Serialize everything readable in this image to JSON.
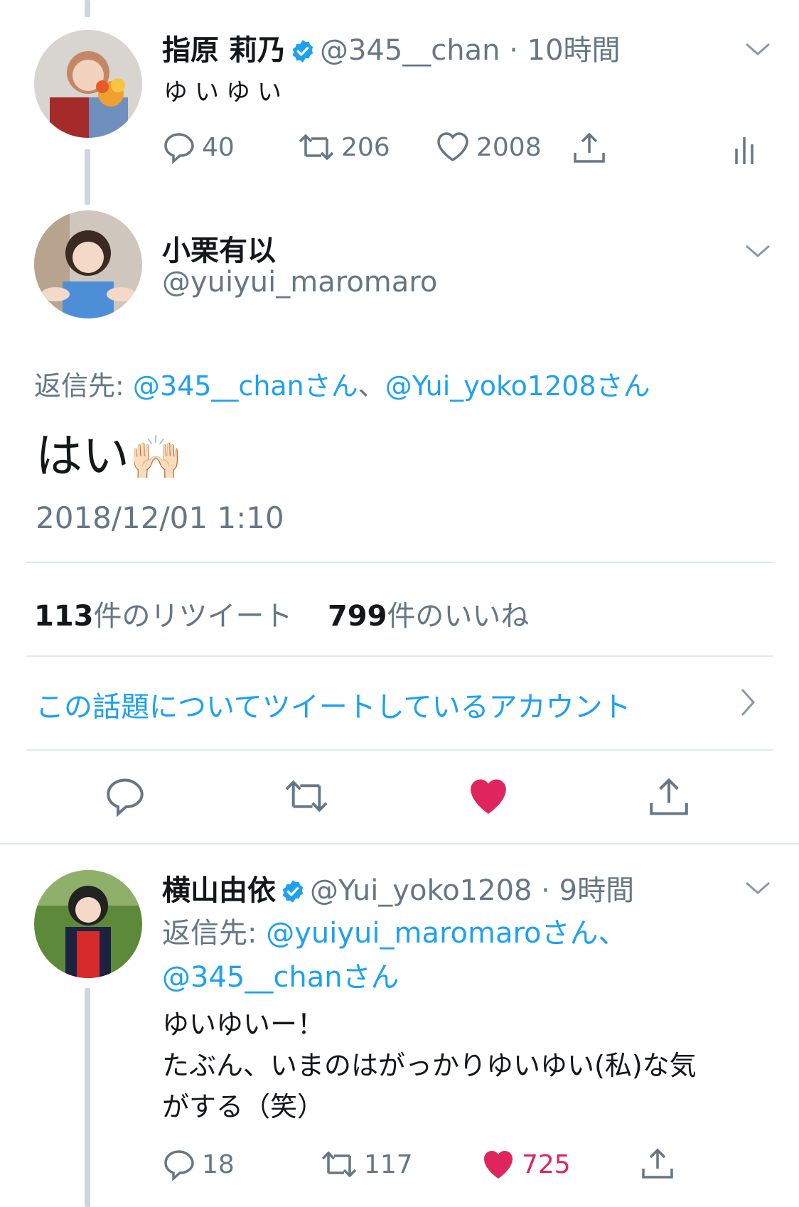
{
  "tweet1": {
    "name": "指原 莉乃",
    "handle": "@345__chan",
    "time": "10時間",
    "text": "ゆいゆい",
    "replies": "40",
    "retweets": "206",
    "likes": "2008"
  },
  "main": {
    "name": "小栗有以",
    "handle": "@yuiyui_maromaro",
    "reply_prefix": "返信先: ",
    "reply_to_1": "@345__chanさん",
    "reply_sep": "、",
    "reply_to_2": "@Yui_yoko1208さん",
    "text": "はい",
    "emoji": "🙌🏻",
    "timestamp": "2018/12/01 1:10",
    "retweet_count": "113",
    "retweet_label": "件のリツイート",
    "like_count": "799",
    "like_label": "件のいいね",
    "topic_link": "この話題についてツイートしているアカウント"
  },
  "tweet3": {
    "name": "横山由依",
    "handle": "@Yui_yoko1208",
    "time": "9時間",
    "reply_prefix": "返信先: ",
    "reply_to_1": "@yuiyui_maromaroさん、",
    "reply_to_2": "@345__chanさん",
    "line1": "ゆいゆいー！",
    "line2": "たぶん、いまのはがっかりゆいゆい(私)な気",
    "line3": "がする（笑）",
    "replies": "18",
    "retweets": "117",
    "likes": "725"
  },
  "colors": {
    "accent": "#1da1f2",
    "like": "#e0245e",
    "muted": "#657786",
    "divider": "#e1e8ed"
  },
  "icons": [
    "chevron-down-icon",
    "verified-badge-icon",
    "reply-icon",
    "retweet-icon",
    "like-icon",
    "share-icon",
    "analytics-icon",
    "chevron-right-icon"
  ]
}
